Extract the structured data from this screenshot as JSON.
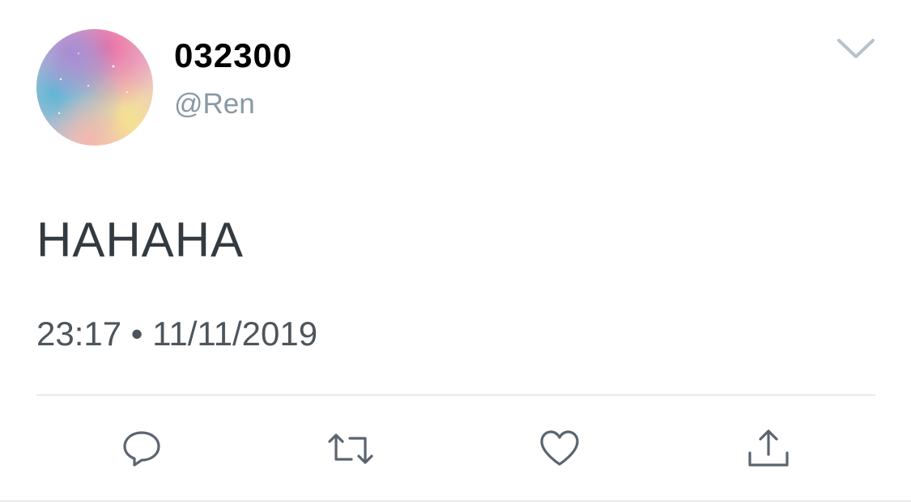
{
  "user": {
    "display_name": "032300",
    "handle": "@Ren",
    "avatar": "pastel-galaxy-avatar"
  },
  "tweet": {
    "text": "HAHAHA",
    "timestamp": "23:17 • 11/11/2019"
  },
  "actions": {
    "reply_icon": "reply-icon",
    "retweet_icon": "retweet-icon",
    "like_icon": "heart-icon",
    "share_icon": "share-icon",
    "menu_icon": "chevron-down-icon"
  },
  "colors": {
    "name": "#000000",
    "handle": "#8899a6",
    "text": "#333a40",
    "timestamp": "#4d555c",
    "icons": "#5a6570",
    "divider": "#d0d6db"
  }
}
